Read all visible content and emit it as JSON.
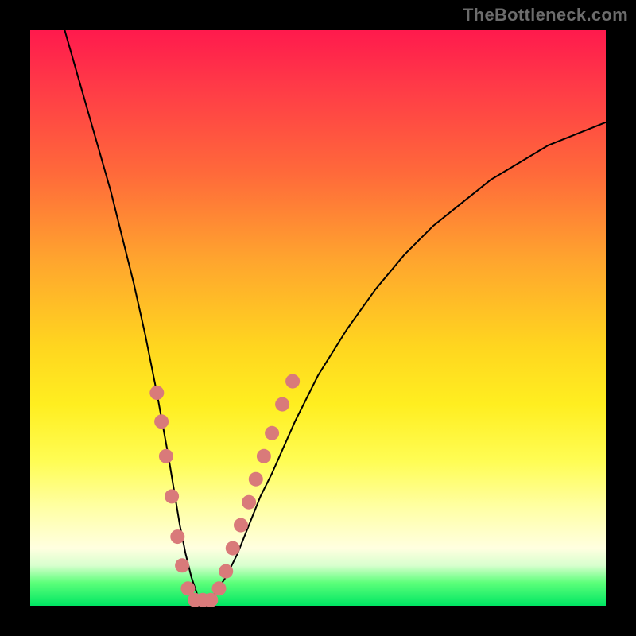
{
  "watermark": "TheBottleneck.com",
  "colors": {
    "curve": "#000000",
    "dot": "#d97a7a",
    "gradient_top": "#ff1a4d",
    "gradient_bottom": "#00e663"
  },
  "chart_data": {
    "type": "line",
    "title": "",
    "xlabel": "",
    "ylabel": "",
    "xlim": [
      0,
      100
    ],
    "ylim": [
      0,
      100
    ],
    "note": "No axes, ticks, legend, or numeric labels are rendered in the image; values below are estimated from pixel positions on a 0–100 normalized scale. y=0 is the green band at the bottom, y=100 is the top.",
    "series": [
      {
        "name": "bottleneck-curve",
        "x": [
          6,
          8,
          10,
          12,
          14,
          16,
          18,
          20,
          22,
          24,
          25,
          26,
          27,
          28,
          29,
          30,
          31,
          32,
          34,
          36,
          38,
          40,
          42,
          46,
          50,
          55,
          60,
          65,
          70,
          75,
          80,
          85,
          90,
          95,
          100
        ],
        "y": [
          100,
          93,
          86,
          79,
          72,
          64,
          56,
          47,
          37,
          26,
          20,
          14,
          9,
          5,
          2,
          1,
          1,
          2,
          5,
          9,
          14,
          19,
          23,
          32,
          40,
          48,
          55,
          61,
          66,
          70,
          74,
          77,
          80,
          82,
          84
        ]
      }
    ],
    "scatter_overlay": {
      "name": "highlighted-points",
      "description": "Salmon-colored dots clustered near the curve's minimum and lower legs",
      "points": [
        {
          "x": 22.0,
          "y": 37
        },
        {
          "x": 22.8,
          "y": 32
        },
        {
          "x": 23.6,
          "y": 26
        },
        {
          "x": 24.6,
          "y": 19
        },
        {
          "x": 25.6,
          "y": 12
        },
        {
          "x": 26.4,
          "y": 7
        },
        {
          "x": 27.4,
          "y": 3
        },
        {
          "x": 28.6,
          "y": 1
        },
        {
          "x": 30.0,
          "y": 1
        },
        {
          "x": 31.4,
          "y": 1
        },
        {
          "x": 32.8,
          "y": 3
        },
        {
          "x": 34.0,
          "y": 6
        },
        {
          "x": 35.2,
          "y": 10
        },
        {
          "x": 36.6,
          "y": 14
        },
        {
          "x": 38.0,
          "y": 18
        },
        {
          "x": 39.2,
          "y": 22
        },
        {
          "x": 40.6,
          "y": 26
        },
        {
          "x": 42.0,
          "y": 30
        },
        {
          "x": 43.8,
          "y": 35
        },
        {
          "x": 45.6,
          "y": 39
        }
      ]
    }
  }
}
